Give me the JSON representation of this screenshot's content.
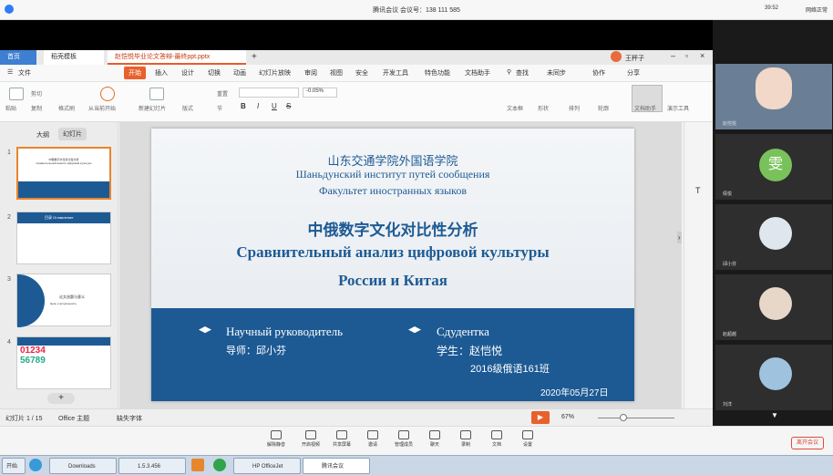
{
  "meeting": {
    "title": "腾讯会议  会议号：138 111 585",
    "time": "39:52",
    "network": "网络正常",
    "leave_label": "离开会议"
  },
  "wps": {
    "tabs": [
      {
        "label": "首页"
      },
      {
        "label": "稻壳模板"
      },
      {
        "label": "赵恺悦毕业论文答辩-最终ppt.pptx"
      }
    ],
    "user": "王秤子",
    "menu": [
      "文件",
      "开始",
      "插入",
      "设计",
      "切换",
      "动画",
      "幻灯片放映",
      "审阅",
      "视图",
      "安全",
      "开发工具",
      "特色功能",
      "文档助手",
      "查找"
    ],
    "menu_right": [
      "未同步",
      "协作",
      "分享"
    ],
    "ribbon": {
      "paste": "粘贴",
      "cut": "剪切",
      "copy": "复制",
      "format_painter": "格式刷",
      "from_current": "从当前开始",
      "new_slide": "新建幻灯片",
      "layout": "版式",
      "reset": "重置",
      "section": "节",
      "font_size_value": "-0.05%",
      "text_box": "文本框",
      "shapes": "形状",
      "arrange": "排列",
      "outline": "轮廓",
      "doc_assistant": "文档助手",
      "presentation_tools": "演示工具"
    },
    "panel_tabs": {
      "outline": "大纲",
      "slides": "幻灯片"
    },
    "thumbs": [
      {
        "num": "1",
        "line1": "中俄数字文化对比性分析",
        "line2": "Сравнительный анализ цифровой культуры"
      },
      {
        "num": "2",
        "line1": "目录",
        "line2": "Оглавление"
      },
      {
        "num": "3",
        "line1": "论文选题与意义",
        "line2": "Цель и актуальность"
      },
      {
        "num": "4",
        "line1": "01234",
        "line2": "56789"
      }
    ],
    "slide": {
      "school_cn": "山东交通学院外国语学院",
      "school_ru1": "Шаньдунский институт путей сообщения",
      "school_ru2": "Факультет иностранных языков",
      "title_cn": "中俄数字文化对比性分析",
      "title_ru1": "Сравнительный анализ цифровой культуры",
      "title_ru2": "России и Китая",
      "advisor_ru": "Научный руководитель",
      "advisor_cn": "导师：邱小芬",
      "student_ru": "Сдудентка",
      "student_cn": "学生：赵恺悦",
      "class": "2016级俄语161班",
      "date": "2020年05月27日"
    },
    "status": {
      "slide_count": "幻灯片 1 / 15",
      "theme": "Office 主题",
      "missing_font": "缺失字体",
      "zoom": "67%"
    }
  },
  "participants": [
    {
      "name": "赵恺悦"
    },
    {
      "name": "倩悦",
      "avatar_char": "雯"
    },
    {
      "name": "邱小芬"
    },
    {
      "name": "赵超越"
    },
    {
      "name": "刘洋"
    }
  ],
  "controls": [
    "解除静音",
    "开启视频",
    "共享屏幕",
    "邀请",
    "管理成员",
    "聊天",
    "录制",
    "文档",
    "设置"
  ],
  "taskbar": {
    "items": [
      "开始",
      "Downloads",
      "1.5.3.456",
      "HP OfficeJet",
      "腾讯会议"
    ]
  }
}
